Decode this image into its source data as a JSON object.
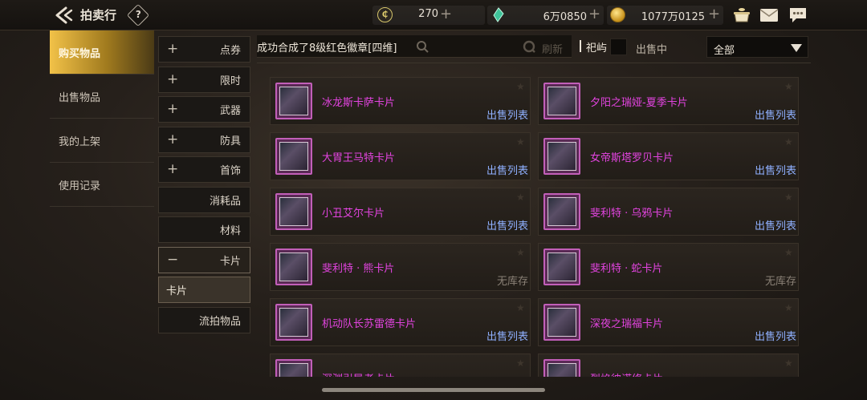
{
  "header": {
    "title": "拍卖行",
    "help": "?",
    "currencies": [
      {
        "icon": "coin-c-icon",
        "value": "270",
        "plus": "+"
      },
      {
        "icon": "green-gem-icon",
        "value": "6万0850",
        "plus": "+"
      },
      {
        "icon": "gold-coin-icon",
        "value": "1077万0125",
        "plus": "+"
      }
    ],
    "icons": [
      "pot-icon",
      "mail-icon",
      "chat-icon"
    ]
  },
  "left_tabs": [
    {
      "label": "购买物品",
      "active": true
    },
    {
      "label": "出售物品",
      "active": false
    },
    {
      "label": "我的上架",
      "active": false
    },
    {
      "label": "使用记录",
      "active": false
    }
  ],
  "categories": [
    {
      "label": "点券",
      "sign": "+"
    },
    {
      "label": "限时",
      "sign": "+"
    },
    {
      "label": "武器",
      "sign": "+"
    },
    {
      "label": "防具",
      "sign": "+"
    },
    {
      "label": "首饰",
      "sign": "+"
    },
    {
      "label": "消耗品",
      "sign": ""
    },
    {
      "label": "材料",
      "sign": ""
    },
    {
      "label": "卡片",
      "sign": "−"
    },
    {
      "label": "卡片",
      "sign": "",
      "sub": true
    },
    {
      "label": "流拍物品",
      "sign": ""
    }
  ],
  "search": {
    "value": "成功合成了8级红色徽章[四维]",
    "refresh_label": "刷新",
    "server_label": "祀屿",
    "onsale_label": "出售中",
    "filter_value": "全部"
  },
  "items": [
    {
      "name": "冰龙斯卡萨卡片",
      "status": "出售列表",
      "in_stock": true
    },
    {
      "name": "夕阳之瑞娅-夏季卡片",
      "status": "出售列表",
      "in_stock": true
    },
    {
      "name": "大胃王马特卡片",
      "status": "出售列表",
      "in_stock": true
    },
    {
      "name": "女帝斯塔罗贝卡片",
      "status": "出售列表",
      "in_stock": true
    },
    {
      "name": "小丑艾尔卡片",
      "status": "出售列表",
      "in_stock": true
    },
    {
      "name": "斐利特 · 乌鸦卡片",
      "status": "出售列表",
      "in_stock": true
    },
    {
      "name": "斐利特 · 熊卡片",
      "status": "无库存",
      "in_stock": false
    },
    {
      "name": "斐利特 · 蛇卡片",
      "status": "无库存",
      "in_stock": false
    },
    {
      "name": "机动队长苏雷德卡片",
      "status": "出售列表",
      "in_stock": true
    },
    {
      "name": "深夜之瑞福卡片",
      "status": "出售列表",
      "in_stock": true
    },
    {
      "name": "深渊引导者卡片",
      "status": "",
      "in_stock": true
    },
    {
      "name": "烈焰彼诺修卡片",
      "status": "",
      "in_stock": true
    }
  ],
  "colors": {
    "accent_gold": "#f2c248",
    "item_name": "#e344e0",
    "status_link": "#8fb0ff",
    "out_of_stock": "#8a8176"
  }
}
